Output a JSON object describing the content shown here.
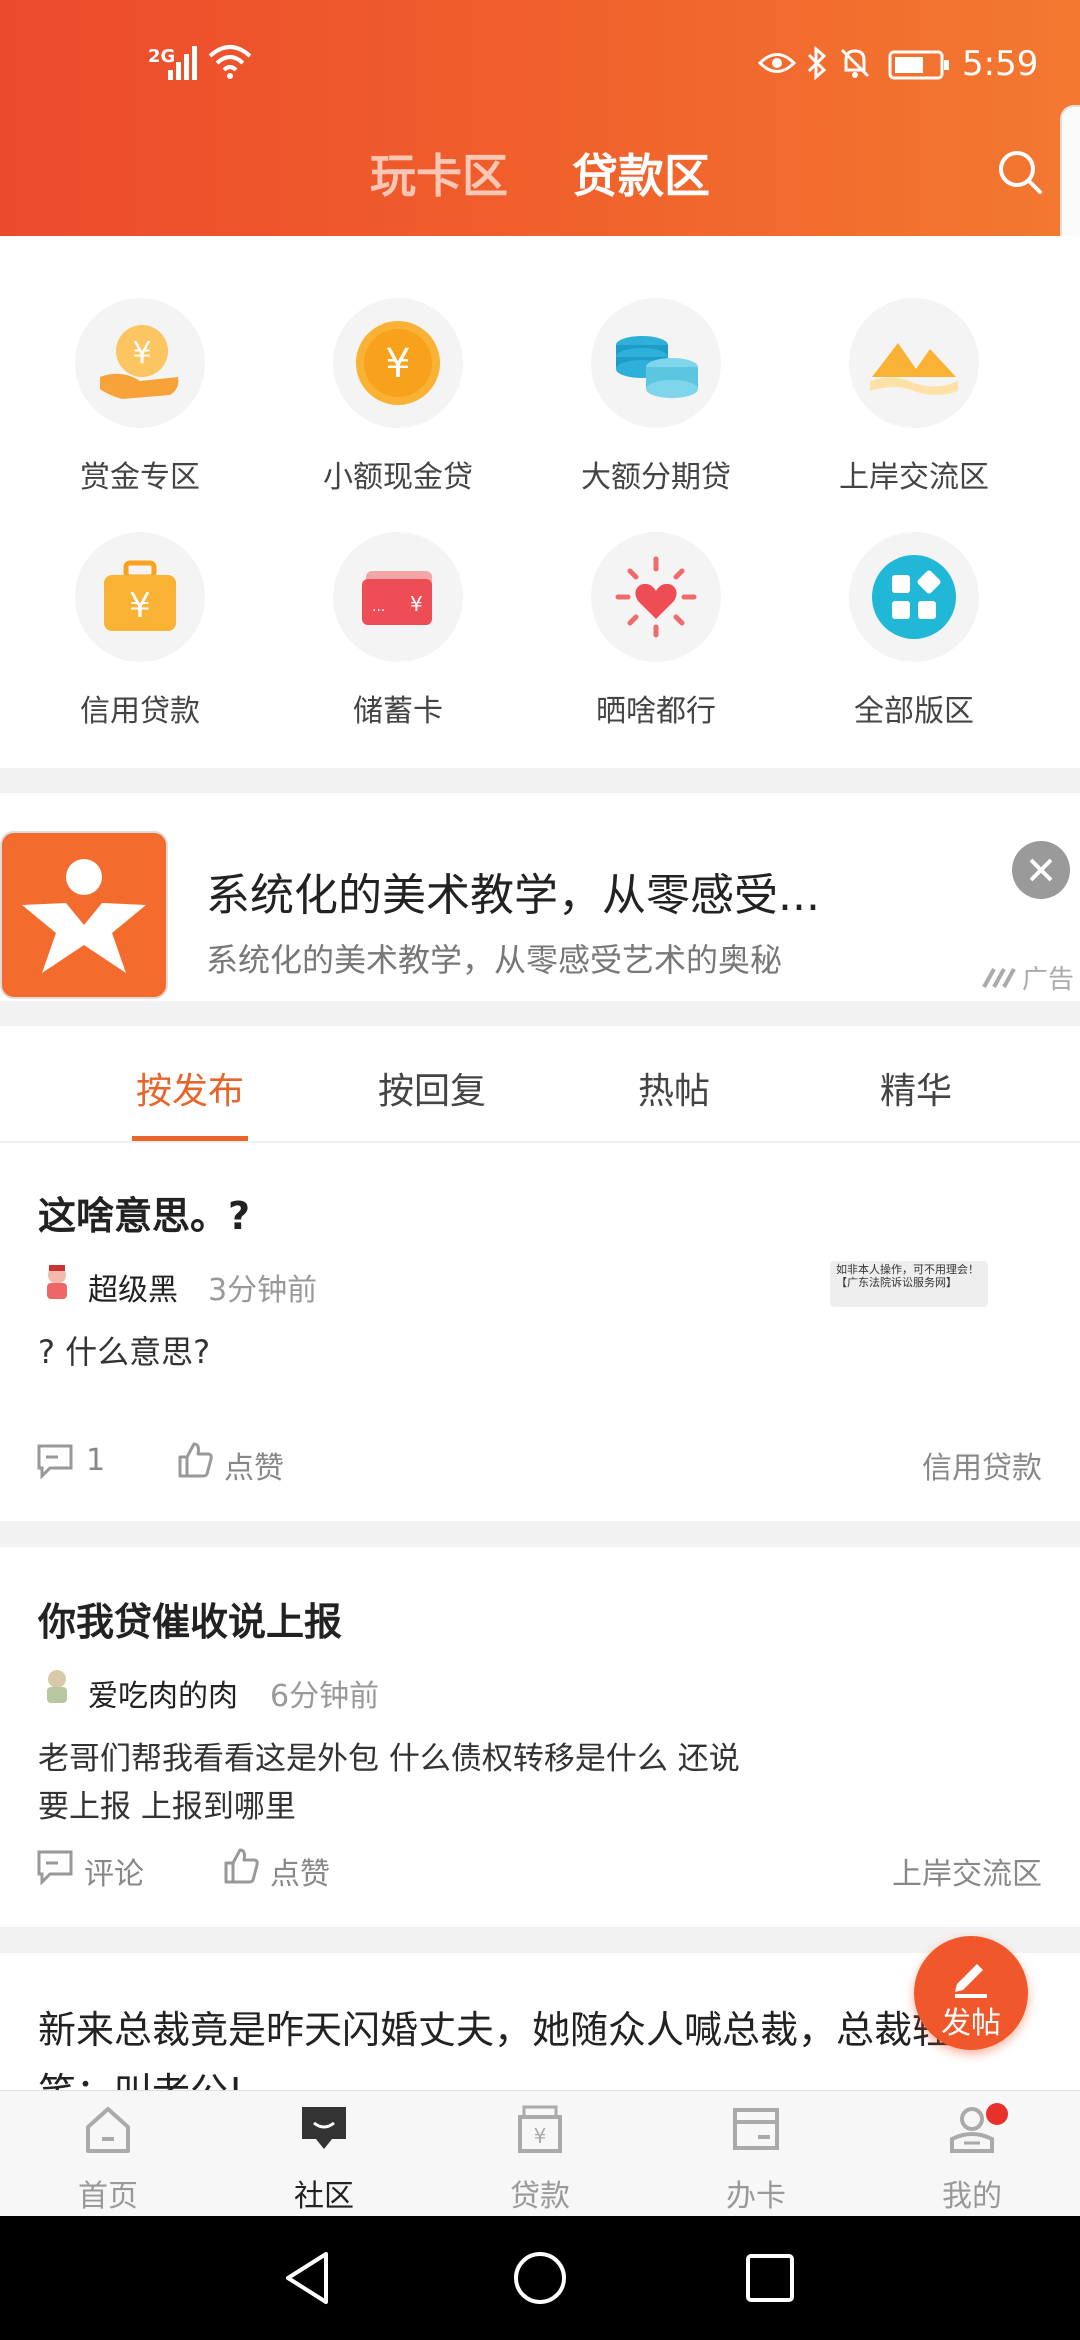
{
  "status_bar": {
    "network": "2G",
    "time": "5:59"
  },
  "header": {
    "tabs": [
      {
        "label": "玩卡区"
      },
      {
        "label": "贷款区"
      }
    ]
  },
  "categories": [
    {
      "label": "赏金专区",
      "icon": "money-hand-icon"
    },
    {
      "label": "小额现金贷",
      "icon": "yuan-coin-icon"
    },
    {
      "label": "大额分期贷",
      "icon": "coin-stack-icon"
    },
    {
      "label": "上岸交流区",
      "icon": "mountain-icon"
    },
    {
      "label": "信用贷款",
      "icon": "yuan-briefcase-icon"
    },
    {
      "label": "储蓄卡",
      "icon": "bank-card-icon"
    },
    {
      "label": "晒啥都行",
      "icon": "heart-sun-icon"
    },
    {
      "label": "全部版区",
      "icon": "all-sections-icon"
    }
  ],
  "ad": {
    "title": "系统化的美术教学，从零感受...",
    "subtitle": "系统化的美术教学，从零感受艺术的奥秘",
    "tag": "广告"
  },
  "sort_tabs": [
    {
      "label": "按发布",
      "active": true
    },
    {
      "label": "按回复",
      "active": false
    },
    {
      "label": "热帖",
      "active": false
    },
    {
      "label": "精华",
      "active": false
    }
  ],
  "posts": [
    {
      "title": "这啥意思。?",
      "author": "超级黑",
      "time": "3分钟前",
      "content": "? 什么意思?",
      "thumbnail_text": "如非本人操作，可不用理会！【广东法院诉讼服务网】",
      "comments": "1",
      "like_label": "点赞",
      "category": "信用贷款"
    },
    {
      "title": "你我贷催收说上报",
      "author": "爱吃肉的肉",
      "time": "6分钟前",
      "content_line1": "老哥们帮我看看这是外包 什么债权转移是什么 还说",
      "content_line2": "要上报 上报到哪里",
      "comments": "评论",
      "like_label": "点赞",
      "category": "上岸交流区"
    },
    {
      "title_line1": "新来总裁竟是昨天闪婚丈夫，她随众人喊总裁，总裁轻",
      "title_line2": "笑：叫老公!"
    }
  ],
  "fab": {
    "label": "发帖"
  },
  "bottom_nav": [
    {
      "label": "首页",
      "active": false
    },
    {
      "label": "社区",
      "active": true
    },
    {
      "label": "贷款",
      "active": false
    },
    {
      "label": "办卡",
      "active": false
    },
    {
      "label": "我的",
      "active": false,
      "badge": true
    }
  ],
  "colors": {
    "accent": "#ef5a2c",
    "active_tab_text": "#e8642a",
    "muted_text": "#888888"
  }
}
